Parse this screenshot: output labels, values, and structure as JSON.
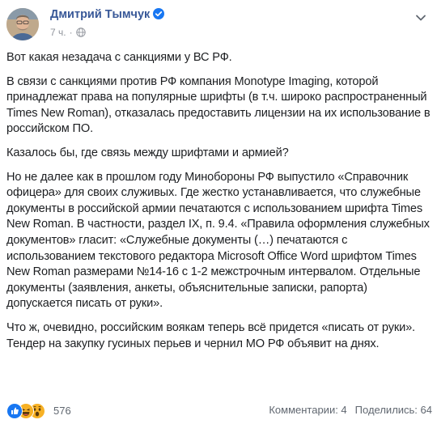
{
  "post": {
    "author": "Дмитрий Тымчук",
    "time": "7 ч.",
    "separator": "·",
    "paragraphs": [
      "Вот какая незадача с санкциями у ВС РФ.",
      "В связи с санкциями против РФ компания Monotype Imaging, которой принадлежат права на популярные шрифты (в т.ч. широко распространенный Times New Roman), отказалась предоставить лицензии на их использование в российском ПО.",
      "Казалось бы, где связь между шрифтами и армией?",
      "Но не далее как в прошлом году Минобороны РФ выпустило «Справочник офицера» для своих служивых. Где жестко устанавливается, что служебные документы в российской армии печатаются с использованием шрифта Times New Roman. В частности, раздел IX, п. 9.4. «Правила оформления служебных документов» гласит: «Служебные документы (…) печатаются с использованием текстового редактора Microsoft Office Word шрифтом Times New Roman размерами №14-16 с 1-2 межстрочным интервалом. Отдельные документы (заявления, анкеты, объяснительные записки, рапорта) допускается писать от руки».",
      "Что ж, очевидно, российским воякам теперь всё придется «писать от руки». Тендер на закупку гусиных перьев и чернил МО РФ объявит на днях."
    ]
  },
  "footer": {
    "reaction_icons": [
      "like-icon",
      "laugh-icon",
      "wow-icon"
    ],
    "reaction_count": "576",
    "comments": "Комментарии: 4",
    "shares": "Поделились: 64"
  },
  "colors": {
    "author": "#385898",
    "meta": "#90949c",
    "text": "#1c1e21",
    "like": "#1877f2",
    "emoji": "#f7b125"
  }
}
